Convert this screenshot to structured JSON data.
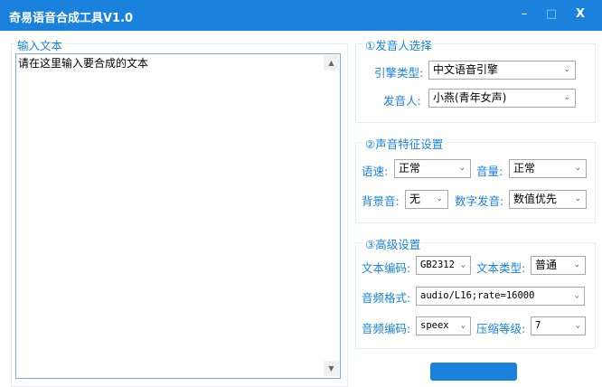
{
  "window": {
    "title": "奇易语音合成工具V1.0",
    "minimize": "–",
    "maximize": "□",
    "close": "X"
  },
  "input": {
    "group_label": "输入文本",
    "text": "请在这里输入要合成的文本"
  },
  "speaker": {
    "group_label": "①发音人选择",
    "engine_label": "引擎类型:",
    "engine_value": "中文语音引擎",
    "voice_label": "发音人:",
    "voice_value": "小燕(青年女声)"
  },
  "voice_features": {
    "group_label": "②声音特征设置",
    "speed_label": "语速:",
    "speed_value": "正常",
    "volume_label": "音量:",
    "volume_value": "正常",
    "bg_label": "背景音:",
    "bg_value": "无",
    "digit_label": "数字发音:",
    "digit_value": "数值优先"
  },
  "advanced": {
    "group_label": "③高级设置",
    "encoding_label": "文本编码:",
    "encoding_value": "GB2312",
    "text_type_label": "文本类型:",
    "text_type_value": "普通",
    "audio_format_label": "音频格式:",
    "audio_format_value": "audio/L16;rate=16000",
    "audio_codec_label": "音频编码:",
    "audio_codec_value": "speex",
    "compress_label": "压缩等级:",
    "compress_value": "7"
  },
  "icons": {
    "dropdown": "⌄",
    "scroll_up": "▲",
    "scroll_down": "▼"
  }
}
